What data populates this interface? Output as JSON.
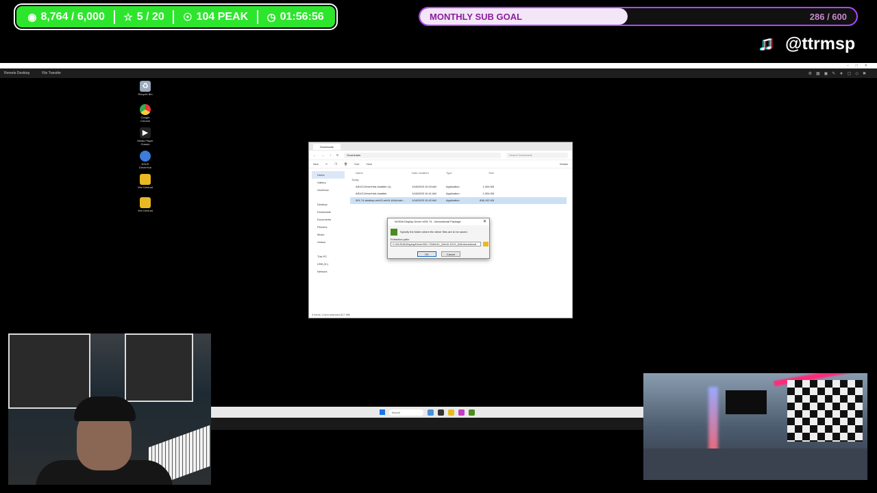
{
  "overlay": {
    "stats": {
      "followers": "8,764 / 6,000",
      "stars": "5 / 20",
      "peak": "104 PEAK",
      "timer": "01:56:56"
    },
    "sub_goal": {
      "label": "MONTHLY SUB GOAL",
      "count": "286 / 600",
      "progress": 0.476
    },
    "tiktok_handle": "@ttrmsp",
    "colors": {
      "stat_bg": "#2ee52e",
      "goal_border": "#b347ff",
      "goal_label": "#8a1e9e"
    }
  },
  "remote_desktop": {
    "menu": {
      "remote_desktop": "Remote Desktop",
      "file_transfer": "File Transfer"
    }
  },
  "desktop_icons": [
    {
      "label": "Recycle Bin",
      "icon": "recycle-bin-icon"
    },
    {
      "label": "Google Chrome",
      "icon": "chrome-icon"
    },
    {
      "label": "Media Player Classic",
      "icon": "media-player-icon"
    },
    {
      "label": "ASUS DriverHub",
      "icon": "asus-icon"
    },
    {
      "label": "Win Debloat",
      "icon": "folder-icon"
    },
    {
      "label": "Win Debloat",
      "icon": "folder-icon"
    }
  ],
  "explorer": {
    "tab_title": "Downloads",
    "address": "Downloads",
    "search_placeholder": "Search Downloads",
    "commands": {
      "new": "New",
      "sort": "Sort",
      "view": "View",
      "details": "Details"
    },
    "nav": {
      "home": "Home",
      "gallery": "Gallery",
      "onedrive": "OneDrive",
      "desktop": "Desktop",
      "downloads": "Downloads",
      "documents": "Documents",
      "pictures": "Pictures",
      "music": "Music",
      "videos": "Videos",
      "this_pc": "This PC",
      "usb": "USB (D:)",
      "network": "Network"
    },
    "columns": {
      "name": "Name",
      "date": "Date modified",
      "type": "Type",
      "size": "Size"
    },
    "group": "Today",
    "files": [
      {
        "name": "ASUS-DriverHub-Installer (1)",
        "date": "1/18/2025 10:43 AM",
        "type": "Application",
        "size": "1,304 KB"
      },
      {
        "name": "ASUS-DriverHub-Installer",
        "date": "1/18/2025 10:41 AM",
        "type": "Application",
        "size": "1,304 KB"
      },
      {
        "name": "591.74-desktop-win10-win11-64bit-inte...",
        "date": "1/18/2025 10:42 AM",
        "type": "Application",
        "size": "836,192 KB"
      }
    ],
    "status": "3 items   1 item selected  817 MB"
  },
  "dialog": {
    "title": "NVIDIA Display Driver v591.74 - International Package",
    "message": "Specify the folder where the driver files are to be saved.",
    "path_label": "Extraction path:",
    "path_value": "C:\\NVIDIA\\DisplayDriver\\591.74\\Win11_Win10-DCH_64\\International",
    "ok": "OK",
    "cancel": "Cancel"
  },
  "taskbar": {
    "search": "Search"
  }
}
